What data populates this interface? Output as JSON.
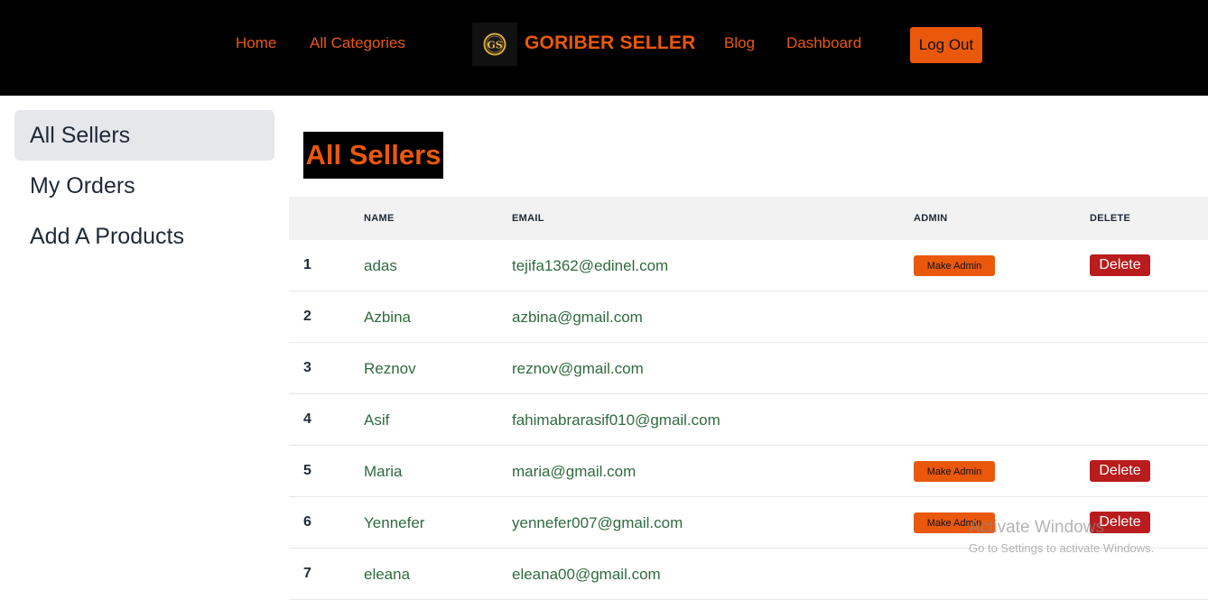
{
  "nav": {
    "home": "Home",
    "categories": "All Categories",
    "brand": "GORIBER SELLER",
    "blog": "Blog",
    "dashboard": "Dashboard",
    "logout": "Log Out",
    "logo_icon": "gs-monogram-logo",
    "accent_color": "#ea580c"
  },
  "sidebar": {
    "items": [
      {
        "label": "All Sellers"
      },
      {
        "label": "My Orders"
      },
      {
        "label": "Add A Products"
      }
    ]
  },
  "main": {
    "title": "All Sellers",
    "columns": {
      "name": "NAME",
      "email": "EMAIL",
      "admin": "ADMIN",
      "delete": "DELETE"
    },
    "make_admin_label": "Make Admin",
    "delete_label": "Delete",
    "rows": [
      {
        "num": "1",
        "name": "adas",
        "email": "tejifa1362@edinel.com",
        "has_actions": true
      },
      {
        "num": "2",
        "name": "Azbina",
        "email": "azbina@gmail.com",
        "has_actions": false
      },
      {
        "num": "3",
        "name": "Reznov",
        "email": "reznov@gmail.com",
        "has_actions": false
      },
      {
        "num": "4",
        "name": "Asif",
        "email": "fahimabrarasif010@gmail.com",
        "has_actions": false
      },
      {
        "num": "5",
        "name": "Maria",
        "email": "maria@gmail.com",
        "has_actions": true
      },
      {
        "num": "6",
        "name": "Yennefer",
        "email": "yennefer007@gmail.com",
        "has_actions": true
      },
      {
        "num": "7",
        "name": "eleana",
        "email": "eleana00@gmail.com",
        "has_actions": false
      }
    ]
  },
  "watermark": {
    "title": "Activate Windows",
    "subtitle": "Go to Settings to activate Windows."
  }
}
